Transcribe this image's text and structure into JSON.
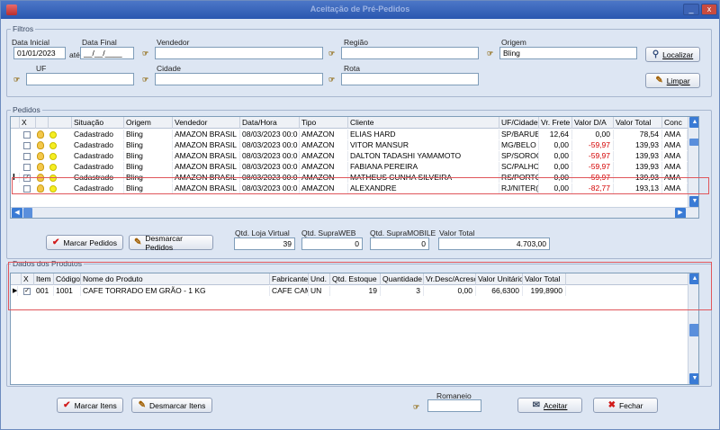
{
  "window": {
    "title": "Aceitação de Pré-Pedidos",
    "minimize": "_",
    "close": "x"
  },
  "filters": {
    "legend": "Filtros",
    "data_inicial_label": "Data Inicial",
    "data_final_label": "Data Final",
    "data_inicial_value": "01/01/2023",
    "ate_label": "até",
    "data_final_value": "__/__/____",
    "vendedor_label": "Vendedor",
    "regiao_label": "Região",
    "origem_label": "Origem",
    "origem_value": "Bling",
    "uf_label": "UF",
    "cidade_label": "Cidade",
    "rota_label": "Rota",
    "localizar_label": "Localizar",
    "limpar_label": "Limpar"
  },
  "pedidos": {
    "legend": "Pedidos",
    "columns": [
      "X",
      "",
      "",
      "Situação",
      "Origem",
      "Vendedor",
      "Data/Hora",
      "Tipo",
      "Cliente",
      "UF/Cidade",
      "Vr. Frete",
      "Valor D/A",
      "Valor Total",
      "Conc"
    ],
    "rows": [
      {
        "checked": "",
        "situacao": "Cadastrado",
        "origem": "Bling",
        "vendedor": "AMAZON BRASIL",
        "data": "08/03/2023 00:0",
        "tipo": "AMAZON",
        "cliente": "ELIAS HARD",
        "uf": "SP/BARUE",
        "frete": "12,64",
        "da": "0,00",
        "total": "78,54",
        "conc": "AMA"
      },
      {
        "checked": "",
        "situacao": "Cadastrado",
        "origem": "Bling",
        "vendedor": "AMAZON BRASIL",
        "data": "08/03/2023 00:0",
        "tipo": "AMAZON",
        "cliente": "VITOR MANSUR",
        "uf": "MG/BELO I",
        "frete": "0,00",
        "da": "-59,97",
        "total": "139,93",
        "conc": "AMA"
      },
      {
        "checked": "",
        "situacao": "Cadastrado",
        "origem": "Bling",
        "vendedor": "AMAZON BRASIL",
        "data": "08/03/2023 00:0",
        "tipo": "AMAZON",
        "cliente": "DALTON TADASHI YAMAMOTO",
        "uf": "SP/SOROC",
        "frete": "0,00",
        "da": "-59,97",
        "total": "139,93",
        "conc": "AMA"
      },
      {
        "checked": "",
        "situacao": "Cadastrado",
        "origem": "Bling",
        "vendedor": "AMAZON BRASIL",
        "data": "08/03/2023 00:0",
        "tipo": "AMAZON",
        "cliente": "FABIANA PEREIRA",
        "uf": "SC/PALHO",
        "frete": "0,00",
        "da": "-59,97",
        "total": "139,93",
        "conc": "AMA"
      },
      {
        "checked": "✓",
        "situacao": "Cadastrado",
        "origem": "Bling",
        "vendedor": "AMAZON BRASIL",
        "data": "08/03/2023 00:0",
        "tipo": "AMAZON",
        "cliente": "MATHEUS CUNHA SILVEIRA",
        "uf": "RS/PORTC",
        "frete": "0,00",
        "da": "-59,97",
        "total": "139,93",
        "conc": "AMA"
      },
      {
        "checked": "",
        "situacao": "Cadastrado",
        "origem": "Bling",
        "vendedor": "AMAZON BRASIL",
        "data": "08/03/2023 00:0",
        "tipo": "AMAZON",
        "cliente": "ALEXANDRE",
        "uf": "RJ/NITER(",
        "frete": "0,00",
        "da": "-82,77",
        "total": "193,13",
        "conc": "AMA"
      }
    ],
    "row_marker": "I",
    "marcar_label": "Marcar Pedidos",
    "desmarcar_label": "Desmarcar Pedidos",
    "qtd_loja_label": "Qtd. Loja Virtual",
    "qtd_loja_value": "39",
    "qtd_supraweb_label": "Qtd. SupraWEB",
    "qtd_supraweb_value": "0",
    "qtd_mobile_label": "Qtd. SupraMOBILE",
    "qtd_mobile_value": "0",
    "valor_total_label": "Valor Total",
    "valor_total_value": "4.703,00"
  },
  "produtos": {
    "legend": "Dados dos Produtos",
    "columns": [
      "X",
      "Item",
      "Código",
      "Nome do Produto",
      "Fabricante",
      "Und.",
      "Qtd. Estoque",
      "Quantidade",
      "Vr.Desc/Acresc",
      "Valor Unitário",
      "Valor Total"
    ],
    "rows": [
      {
        "marker": "▶",
        "checked": "✓",
        "item": "001",
        "codigo": "1001",
        "nome": "CAFE TORRADO EM GRÃO - 1 KG",
        "fabricante": "CAFE CAMPOS AL",
        "und": "UN",
        "estoque": "19",
        "quantidade": "3",
        "desc": "0,00",
        "unitario": "66,6300",
        "total": "199,8900"
      }
    ]
  },
  "footer": {
    "marcar_itens_label": "Marcar Itens",
    "desmarcar_itens_label": "Desmarcar Itens",
    "romaneio_label": "Romaneio",
    "aceitar_label": "Aceitar",
    "fechar_label": "Fechar"
  },
  "colors": {
    "accent": "#3a7bd5",
    "negative": "#d40000",
    "highlight_box": "#e0565b"
  },
  "icons": [
    "app-icon",
    "lookup-icon",
    "search-icon",
    "eraser-icon",
    "check-icon",
    "bulb-icon",
    "status-dot-icon",
    "accept-icon",
    "close-x-icon"
  ]
}
